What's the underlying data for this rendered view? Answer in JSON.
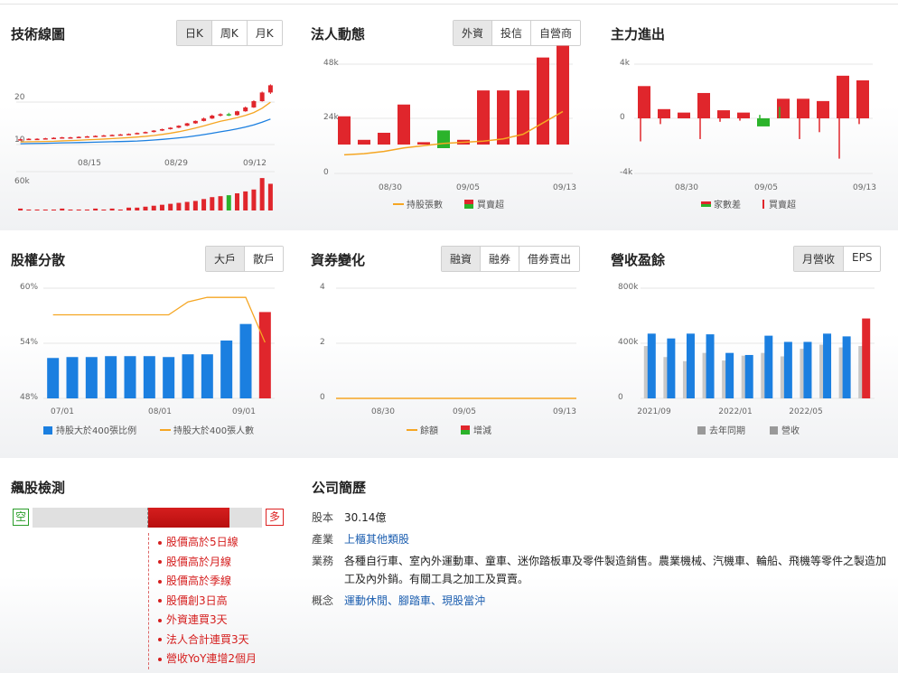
{
  "tech": {
    "title": "技術線圖",
    "buttons": [
      "日K",
      "周K",
      "月K"
    ],
    "y_labels": [
      "20",
      "10"
    ],
    "x_labels": [
      "08/15",
      "08/29",
      "09/12"
    ],
    "vol_label": "60k",
    "chart_data": {
      "type": "candlestick",
      "dates": [
        "08/15",
        "08/29",
        "09/12"
      ],
      "ylim": [
        10,
        25
      ],
      "ohlc": [
        [
          11,
          11.2,
          10.9,
          11.1
        ],
        [
          11.1,
          11.3,
          11,
          11.2
        ],
        [
          11.2,
          11.3,
          11.1,
          11.2
        ],
        [
          11.2,
          11.4,
          11.1,
          11.3
        ],
        [
          11.3,
          11.5,
          11.2,
          11.4
        ],
        [
          11.4,
          11.6,
          11.3,
          11.5
        ],
        [
          11.5,
          11.6,
          11.4,
          11.5
        ],
        [
          11.5,
          11.7,
          11.4,
          11.6
        ],
        [
          11.6,
          11.8,
          11.5,
          11.7
        ],
        [
          11.7,
          11.9,
          11.6,
          11.8
        ],
        [
          11.8,
          12.0,
          11.7,
          11.9
        ],
        [
          11.9,
          12.1,
          11.8,
          12.0
        ],
        [
          12.0,
          12.2,
          11.9,
          12.1
        ],
        [
          12.1,
          12.3,
          12.0,
          12.2
        ],
        [
          12.2,
          12.5,
          12.1,
          12.4
        ],
        [
          12.4,
          12.7,
          12.3,
          12.6
        ],
        [
          12.6,
          13.0,
          12.5,
          12.9
        ],
        [
          12.9,
          13.3,
          12.8,
          13.2
        ],
        [
          13.2,
          13.6,
          13.1,
          13.5
        ],
        [
          13.5,
          14.0,
          13.4,
          13.9
        ],
        [
          13.9,
          14.5,
          13.8,
          14.4
        ],
        [
          14.4,
          15.0,
          14.3,
          14.9
        ],
        [
          14.9,
          15.6,
          14.8,
          15.4
        ],
        [
          15.4,
          16.2,
          15.3,
          16.0
        ],
        [
          16.0,
          16.5,
          15.8,
          16.3
        ],
        [
          16.3,
          16.6,
          15.9,
          16.1
        ],
        [
          16.1,
          17.0,
          16.0,
          16.9
        ],
        [
          16.9,
          17.9,
          16.8,
          17.7
        ],
        [
          17.7,
          19.2,
          17.6,
          19.0
        ],
        [
          19.0,
          21.0,
          18.9,
          20.8
        ],
        [
          20.8,
          22.5,
          20.5,
          22.3
        ]
      ],
      "volume": [
        2,
        1,
        1,
        1,
        1,
        2,
        1,
        1,
        1,
        2,
        1,
        2,
        1,
        3,
        3,
        4,
        5,
        6,
        7,
        8,
        9,
        10,
        12,
        14,
        15,
        16,
        18,
        20,
        22,
        34,
        28
      ]
    }
  },
  "inst": {
    "title": "法人動態",
    "buttons": [
      "外資",
      "投信",
      "自營商"
    ],
    "y_labels": [
      "48k",
      "24k",
      "0"
    ],
    "x_labels": [
      "08/30",
      "09/05",
      "09/13"
    ],
    "legend": [
      "持股張數",
      "買賣超"
    ],
    "chart_data": {
      "type": "bar",
      "ylim": [
        0,
        48
      ],
      "values": [
        12,
        2,
        5,
        17,
        1,
        6,
        2,
        23,
        23,
        23,
        37,
        42
      ],
      "line": [
        7,
        7.5,
        8.5,
        10,
        11,
        12,
        12.5,
        13,
        14,
        16,
        21,
        26
      ]
    }
  },
  "main": {
    "title": "主力進出",
    "y_labels": [
      "4k",
      "0",
      "-4k"
    ],
    "x_labels": [
      "08/30",
      "09/05",
      "09/13"
    ],
    "legend": [
      "家數差",
      "買賣超"
    ],
    "chart_data": {
      "type": "bar",
      "ylim": [
        -4,
        4
      ],
      "values": [
        2.8,
        0.8,
        0.5,
        2.2,
        0.7,
        0.5,
        -0.7,
        1.7,
        1.7,
        1.5,
        3.7,
        3.3
      ],
      "family_diff": [
        -2,
        -0.5,
        0,
        -1.8,
        -0.3,
        -0.2,
        0.3,
        1.0,
        -1.8,
        -1.2,
        -3.5,
        -0.5
      ]
    }
  },
  "share": {
    "title": "股權分散",
    "buttons": [
      "大戶",
      "散戶"
    ],
    "y_labels": [
      "60%",
      "54%",
      "48%"
    ],
    "x_labels": [
      "07/01",
      "08/01",
      "09/01"
    ],
    "legend": [
      "持股大於400張比例",
      "持股大於400張人數"
    ],
    "chart_data": {
      "type": "bar",
      "ylim": [
        48,
        60
      ],
      "values": [
        52.4,
        52.5,
        52.5,
        52.6,
        52.6,
        52.6,
        52.5,
        52.8,
        52.8,
        54.3,
        56.1,
        57.4
      ],
      "line": [
        57.1,
        57.1,
        57.1,
        57.1,
        57.1,
        57.1,
        57.1,
        58.5,
        59.0,
        59.0,
        59.0,
        54.1
      ]
    }
  },
  "margin": {
    "title": "資券變化",
    "buttons": [
      "融資",
      "融券",
      "借券賣出"
    ],
    "y_labels": [
      "4",
      "2",
      "0"
    ],
    "x_labels": [
      "08/30",
      "09/05",
      "09/13"
    ],
    "legend": [
      "餘額",
      "增減"
    ]
  },
  "revenue": {
    "title": "營收盈餘",
    "buttons": [
      "月營收",
      "EPS"
    ],
    "y_labels": [
      "800k",
      "400k",
      "0"
    ],
    "x_labels": [
      "2021/09",
      "2022/01",
      "2022/05"
    ],
    "legend": [
      "去年同期",
      "營收"
    ],
    "chart_data": {
      "type": "bar",
      "ylim": [
        0,
        800
      ],
      "series": [
        {
          "name": "去年同期",
          "values": [
            380,
            300,
            270,
            330,
            275,
            310,
            330,
            305,
            360,
            390,
            370,
            380
          ]
        },
        {
          "name": "營收",
          "values": [
            470,
            435,
            470,
            465,
            330,
            315,
            455,
            410,
            410,
            470,
            450,
            580
          ]
        }
      ]
    }
  },
  "detect": {
    "title": "飆股檢測",
    "empty": "空",
    "full": "多",
    "score": 0.67,
    "signals": [
      "股價高於5日線",
      "股價高於月線",
      "股價高於季線",
      "股價創3日高",
      "外資連買3天",
      "法人合計連買3天",
      "營收YoY連增2個月"
    ]
  },
  "company": {
    "title": "公司簡歷",
    "capital_label": "股本",
    "capital": "30.14億",
    "industry_label": "產業",
    "industry": "上櫃其他類股",
    "business_label": "業務",
    "business": "各種自行車、室內外運動車、童車、迷你踏板車及零件製造銷售。農業機械、汽機車、輪船、飛機等零件之製造加工及內外銷。有關工具之加工及買賣。",
    "concept_label": "概念",
    "concepts": [
      "運動休閒",
      "腳踏車",
      "現股當沖"
    ],
    "sep": "、"
  },
  "colors": {
    "up": "#e0262c",
    "down": "#2bb32b",
    "blue": "#1b7fe0",
    "orange": "#f5a623",
    "gray": "#c8c8c8"
  }
}
